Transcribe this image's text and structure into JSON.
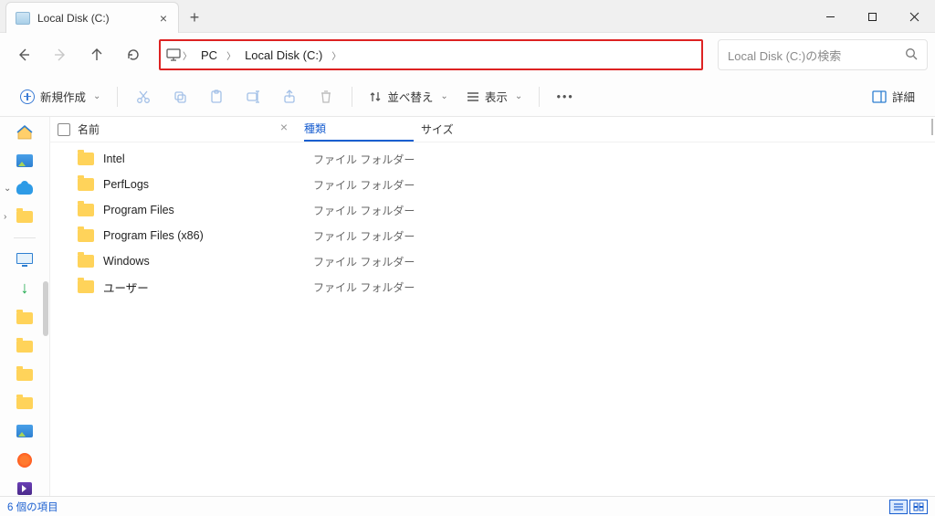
{
  "window": {
    "tab_title": "Local Disk (C:)"
  },
  "breadcrumb": {
    "seg1": "PC",
    "seg2": "Local Disk (C:)"
  },
  "search": {
    "placeholder": "Local Disk (C:)の検索"
  },
  "toolbar": {
    "new_label": "新規作成",
    "sort_label": "並べ替え",
    "view_label": "表示",
    "details_label": "詳細"
  },
  "columns": {
    "name": "名前",
    "type": "種類",
    "size": "サイズ"
  },
  "items": [
    {
      "name": "Intel",
      "type": "ファイル フォルダー"
    },
    {
      "name": "PerfLogs",
      "type": "ファイル フォルダー"
    },
    {
      "name": "Program Files",
      "type": "ファイル フォルダー"
    },
    {
      "name": "Program Files (x86)",
      "type": "ファイル フォルダー"
    },
    {
      "name": "Windows",
      "type": "ファイル フォルダー"
    },
    {
      "name": "ユーザー",
      "type": "ファイル フォルダー"
    }
  ],
  "status": {
    "count_text": "6 個の項目"
  }
}
